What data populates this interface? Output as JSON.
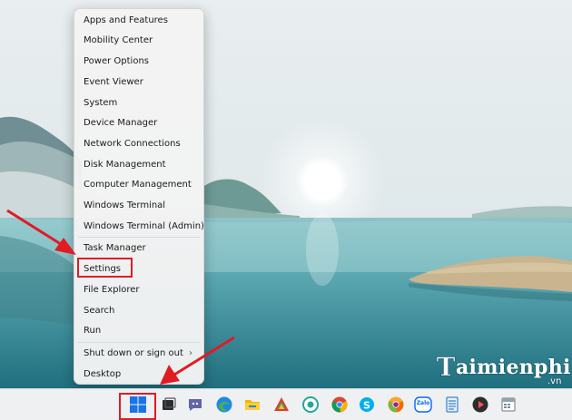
{
  "context_menu": {
    "items": [
      {
        "label": "Apps and Features"
      },
      {
        "label": "Mobility Center"
      },
      {
        "label": "Power Options"
      },
      {
        "label": "Event Viewer"
      },
      {
        "label": "System"
      },
      {
        "label": "Device Manager"
      },
      {
        "label": "Network Connections"
      },
      {
        "label": "Disk Management"
      },
      {
        "label": "Computer Management"
      },
      {
        "label": "Windows Terminal"
      },
      {
        "label": "Windows Terminal (Admin)"
      },
      {
        "label": "Task Manager"
      },
      {
        "label": "Settings"
      },
      {
        "label": "File Explorer"
      },
      {
        "label": "Search"
      },
      {
        "label": "Run"
      },
      {
        "label": "Shut down or sign out",
        "has_submenu": true
      },
      {
        "label": "Desktop"
      }
    ],
    "highlighted_item": "Settings"
  },
  "taskbar": {
    "icons": [
      "windows-start-icon",
      "task-view-icon",
      "teams-chat-icon",
      "edge-icon",
      "file-explorer-icon",
      "store-icon",
      "app-icon",
      "chrome-icon",
      "skype-icon",
      "chrome-canary-icon",
      "zalo-icon",
      "notepad-icon",
      "media-player-icon",
      "calendar-icon"
    ],
    "zalo_label": "Zalo"
  },
  "watermark": {
    "brand": "aimienphi",
    "logo_letter": "T",
    "suffix": ".vn"
  },
  "colors": {
    "annotation_red": "#e01b24",
    "menu_bg": "#f3f3f3",
    "windows_blue": "#1a73e8"
  }
}
